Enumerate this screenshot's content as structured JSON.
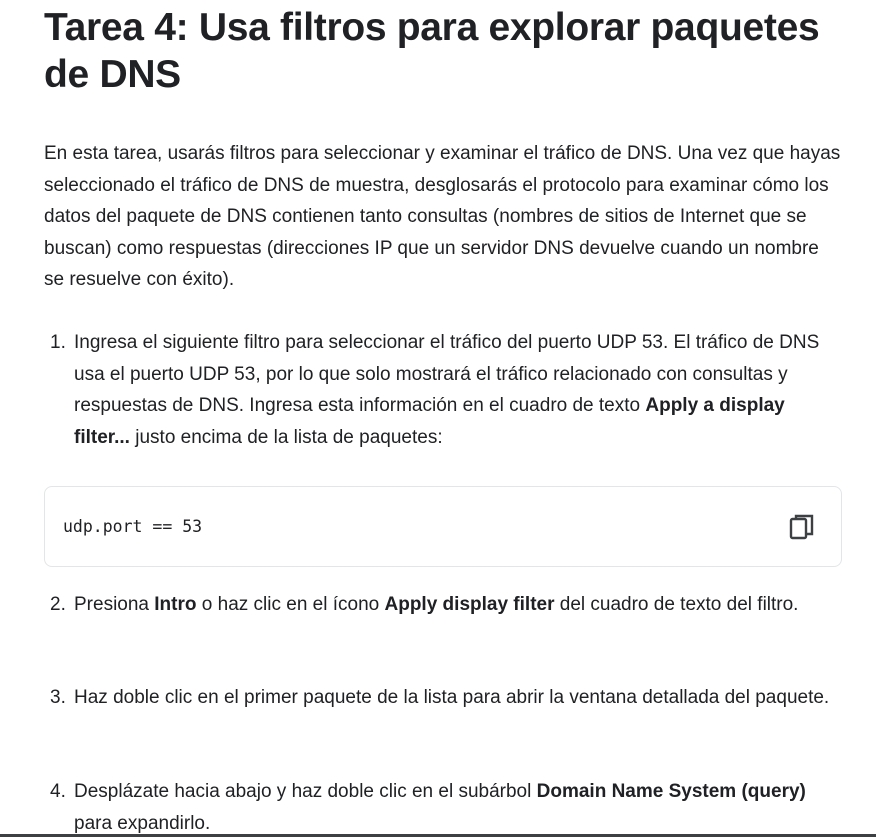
{
  "heading": "Tarea 4: Usa filtros para explorar paquetes de DNS",
  "intro": "En esta tarea, usarás filtros para seleccionar y examinar el tráfico de DNS. Una vez que hayas seleccionado el tráfico de DNS de muestra, desglosarás el protocolo para examinar cómo los datos del paquete de DNS contienen tanto consultas (nombres de sitios de Internet que se buscan) como respuestas (direcciones IP que un servidor DNS devuelve cuando un nombre se resuelve con éxito).",
  "steps": [
    {
      "number": "1.",
      "text_before": "Ingresa el siguiente filtro para seleccionar el tráfico del puerto UDP 53. El tráfico de DNS usa el puerto UDP 53, por lo que solo mostrará el tráfico relacionado con consultas y respuestas de DNS. Ingresa esta información en el cuadro de texto ",
      "bold": "Apply a display filter...",
      "text_after": " justo encima de la lista de paquetes:"
    },
    {
      "number": "2.",
      "text_before": "Presiona ",
      "bold1": "Intro",
      "text_middle": " o haz clic en el ícono ",
      "bold2": "Apply display filter",
      "text_after": " del cuadro de texto del filtro."
    },
    {
      "number": "3.",
      "text": "Haz doble clic en el primer paquete de la lista para abrir la ventana detallada del paquete."
    },
    {
      "number": "4.",
      "text_before": "Desplázate hacia abajo y haz doble clic en el subárbol ",
      "bold": "Domain Name System (query)",
      "text_after": " para expandirlo."
    }
  ],
  "code_block": {
    "code": "udp.port == 53",
    "copy_icon": "copy-icon"
  }
}
